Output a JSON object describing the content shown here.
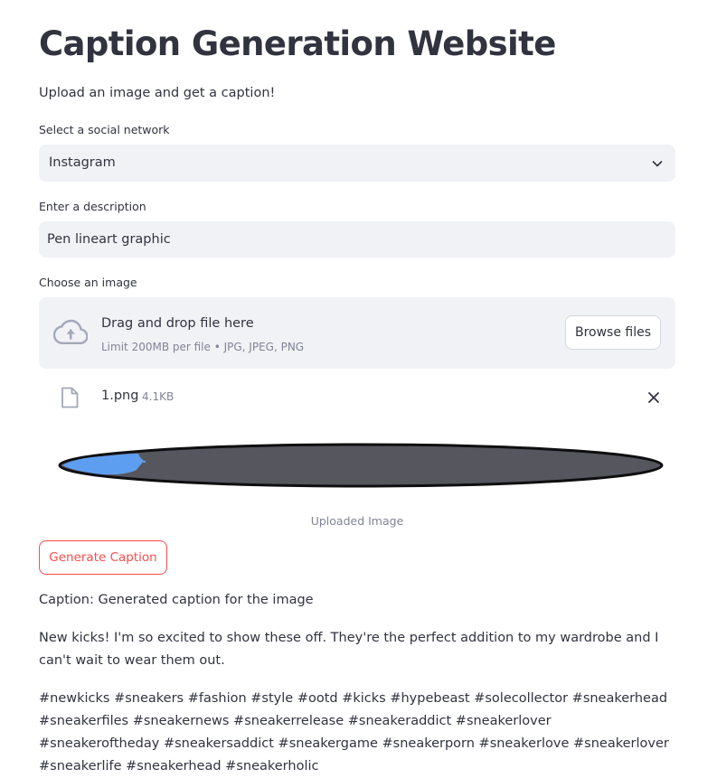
{
  "page": {
    "title": "Caption Generation Website",
    "subtitle": "Upload an image and get a caption!"
  },
  "social_select": {
    "label": "Select a social network",
    "value": "Instagram",
    "icon": "chevron-down-icon"
  },
  "description": {
    "label": "Enter a description",
    "value": "Pen lineart graphic"
  },
  "uploader": {
    "label": "Choose an image",
    "drop_title": "Drag and drop file here",
    "drop_limits": "Limit 200MB per file • JPG, JPEG, PNG",
    "browse_label": "Browse files",
    "icon": "cloud-upload-icon"
  },
  "file": {
    "name": "1.png",
    "size": "4.1KB",
    "icon": "file-icon",
    "remove_icon": "close-icon"
  },
  "image": {
    "caption": "Uploaded Image"
  },
  "generate": {
    "label": "Generate Caption",
    "color": "#ff4b4b"
  },
  "output": {
    "caption_line": "Caption: Generated caption for the image",
    "body": "New kicks! I'm so excited to show these off. They're the perfect addition to my wardrobe and I can't wait to wear them out.",
    "hashtags": "#newkicks #sneakers #fashion #style #ootd #kicks #hypebeast #solecollector #sneakerhead #sneakerfiles #sneakernews #sneakerrelease #sneakeraddict #sneakerlover #sneakeroftheday #sneakersaddict #sneakergame #sneakerporn #sneakerlove #sneakerlover #sneakerlife #sneakerhead #sneakerholic"
  }
}
